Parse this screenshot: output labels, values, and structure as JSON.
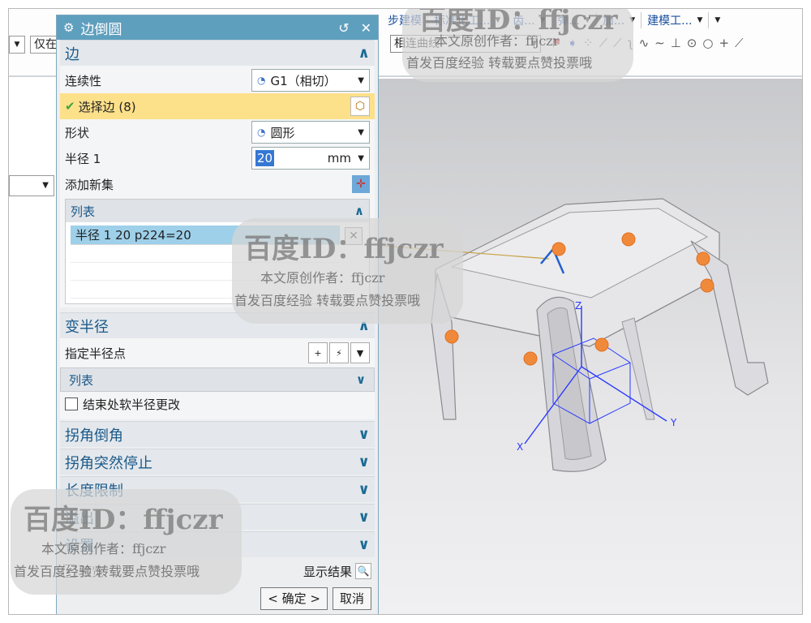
{
  "menu": [
    {
      "label": "步建模"
    },
    {
      "label": "标准化工..."
    },
    {
      "label": "齿..."
    },
    {
      "label": "弹..."
    },
    {
      "label": "加..."
    },
    {
      "label": "建模工..."
    }
  ],
  "filter": {
    "only_label": "仅在",
    "curve_rule": "相连曲线"
  },
  "dialog": {
    "title": "边倒圆",
    "edge_section": {
      "title": "边",
      "continuity_label": "连续性",
      "continuity_value": "G1（相切）",
      "select_edge_label": "选择边 (8)",
      "shape_label": "形状",
      "shape_value": "圆形",
      "radius_label": "半径 1",
      "radius_value": "20",
      "radius_unit": "mm",
      "add_set_label": "添加新集",
      "list_title": "列表",
      "list_row": "半径 1  20  p224=20"
    },
    "var_radius": {
      "title": "变半径",
      "specify_point_label": "指定半径点",
      "list_title": "列表",
      "soft_change_label": "结束处软半径更改"
    },
    "collapsed_sections": [
      {
        "title": "拐角倒角"
      },
      {
        "title": "拐角突然停止"
      },
      {
        "title": "长度限制"
      },
      {
        "title": "溢出"
      },
      {
        "title": "设置"
      }
    ],
    "preview_label": "预览",
    "show_result_label": "显示结果",
    "ok_label": "< 确定 >",
    "cancel_label": "取消"
  },
  "axes": {
    "x": "X",
    "y": "Y",
    "z": "Z"
  },
  "watermarks": {
    "id_text": "百度ID：ffjczr",
    "author_line": "本文原创作者：ffjczr",
    "promo_line": "首发百度经验  转载要点赞投票哦"
  }
}
